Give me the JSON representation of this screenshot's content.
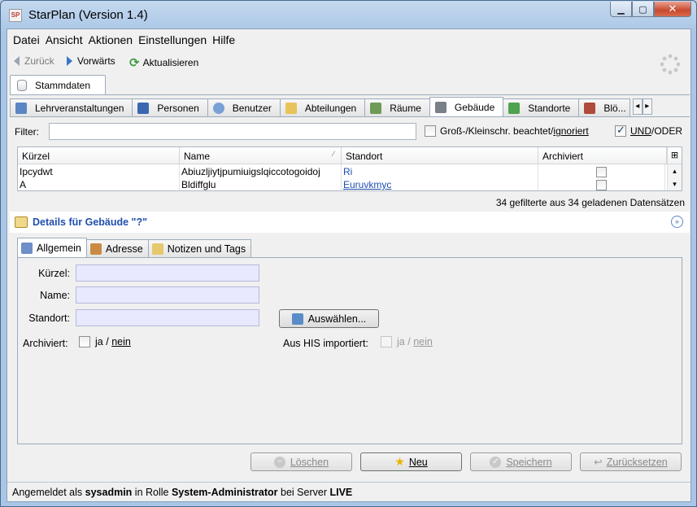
{
  "window": {
    "title": "StarPlan (Version 1.4)",
    "app_icon_text": "SP",
    "controls": {
      "minimize": "▁",
      "maximize": "▢",
      "close": "✕"
    }
  },
  "menu": [
    {
      "label": "Datei"
    },
    {
      "label": "Ansicht"
    },
    {
      "label": "Aktionen"
    },
    {
      "label": "Einstellungen"
    },
    {
      "label": "Hilfe"
    }
  ],
  "nav": {
    "back": "Zurück",
    "forward": "Vorwärts",
    "refresh": "Aktualisieren",
    "refresh_icon": "⟳"
  },
  "main_tab": {
    "label": "Stammdaten"
  },
  "subtabs": [
    {
      "label": "Lehrveranstaltungen",
      "icon": "lecture-icon",
      "color": "#5b86c4"
    },
    {
      "label": "Personen",
      "icon": "person-icon",
      "color": "#3a67b0"
    },
    {
      "label": "Benutzer",
      "icon": "user-icon",
      "color": "#7aa0d8"
    },
    {
      "label": "Abteilungen",
      "icon": "folder-icon",
      "color": "#e8c35a"
    },
    {
      "label": "Räume",
      "icon": "room-icon",
      "color": "#6f9b57"
    },
    {
      "label": "Gebäude",
      "icon": "building-icon",
      "color": "#7a7f88",
      "active": true
    },
    {
      "label": "Standorte",
      "icon": "location-icon",
      "color": "#4fa24f"
    },
    {
      "label": "Blö...",
      "icon": "block-icon",
      "color": "#b04a3a"
    }
  ],
  "tab_scroll": {
    "left": "◂",
    "right": "▸"
  },
  "filter": {
    "label": "Filter:",
    "value": "",
    "case_label_1": "Groß-/Kleinschr. beachtet/",
    "case_label_2": "ignoriert",
    "case_checked": false,
    "undor_label_1": "UND",
    "undor_label_2": "/ODER",
    "undor_checked": true
  },
  "table": {
    "columns": [
      "Kürzel",
      "Name",
      "Standort",
      "Archiviert"
    ],
    "sort_marker": "⁄",
    "corner": "⊞",
    "scroll_up": "▴",
    "scroll_down": "▾",
    "rows": [
      {
        "kuerzel": "Ipcydwt",
        "name": "Abiuzljiytjpumiuigslqiccotogoidoj",
        "standort": "Ri",
        "archiviert": false
      },
      {
        "kuerzel": "A",
        "name": "Bldiffglu",
        "standort": "Euruvkmyc",
        "archiviert": false
      }
    ]
  },
  "count_text": "34 gefilterte aus 34 geladenen Datensätzen",
  "details": {
    "title": "Details für Gebäude \"?\"",
    "collapse_icon": "»",
    "tabs": [
      {
        "label": "Allgemein",
        "active": true
      },
      {
        "label": "Adresse"
      },
      {
        "label": "Notizen und Tags"
      }
    ],
    "fields": {
      "kuerzel_label": "Kürzel:",
      "name_label": "Name:",
      "standort_label": "Standort:",
      "pick_button": "Auswählen...",
      "archiviert_label": "Archiviert:",
      "his_label": "Aus HIS importiert:",
      "ja": "ja",
      "slash": "/",
      "nein": "nein"
    }
  },
  "actions": {
    "delete": "Löschen",
    "new": "Neu",
    "save": "Speichern",
    "reset": "Zurücksetzen",
    "delete_icon": "−",
    "new_icon": "★",
    "save_icon": "✓",
    "reset_icon": "↩"
  },
  "status": {
    "prefix": "Angemeldet als ",
    "user": "sysadmin",
    "mid": " in Rolle ",
    "role": "System-Administrator",
    "mid2": " bei Server ",
    "server": "LIVE"
  }
}
